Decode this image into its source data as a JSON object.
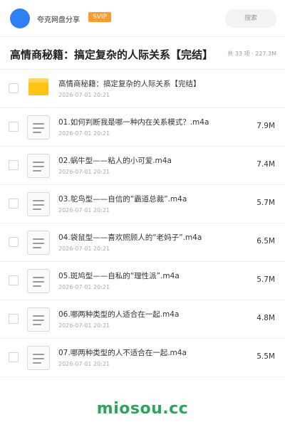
{
  "header": {
    "app_name": "夸克网盘分享",
    "badge": "SVIP",
    "search_placeholder": "搜索"
  },
  "folder": {
    "title": "高情商秘籍：搞定复杂的人际关系【完结】",
    "summary": "共 33 项 · 227.3M"
  },
  "items": [
    {
      "type": "folder",
      "icon": "folder-icon",
      "name": "高情商秘籍：搞定复杂的人际关系【完结】",
      "date": "2026-07-01 20:21",
      "size": ""
    },
    {
      "type": "file",
      "icon": "file-icon",
      "name": "01.如何判断我是哪一种内在关系模式？.m4a",
      "date": "2026-07-01 20:21",
      "size": "7.9M"
    },
    {
      "type": "file",
      "icon": "file-icon",
      "name": "02.蜗牛型——粘人的小可爱.m4a",
      "date": "2026-07-01 20:21",
      "size": "7.4M"
    },
    {
      "type": "file",
      "icon": "file-icon",
      "name": "03.鸵鸟型——自信的“霸道总裁”.m4a",
      "date": "2026-07-01 20:21",
      "size": "5.7M"
    },
    {
      "type": "file",
      "icon": "file-icon",
      "name": "04.袋鼠型——喜欢照顾人的“老妈子”.m4a",
      "date": "2026-07-01 20:21",
      "size": "6.5M"
    },
    {
      "type": "file",
      "icon": "file-icon",
      "name": "05.斑鸠型——自私的“理性派”.m4a",
      "date": "2026-07-01 20:21",
      "size": "5.7M"
    },
    {
      "type": "file",
      "icon": "file-icon",
      "name": "06.哪两种类型的人适合在一起.m4a",
      "date": "2026-07-01 20:21",
      "size": "4.8M"
    },
    {
      "type": "file",
      "icon": "file-icon",
      "name": "07.哪两种类型的人不适合在一起.m4a",
      "date": "2026-07-01 20:21",
      "size": "5.5M"
    }
  ],
  "watermark": "miosou.cc",
  "colors": {
    "accent": "#2f7ff5",
    "badge": "#ff9c2b",
    "folder": "#ffc414",
    "watermark": "#2ca55a"
  }
}
